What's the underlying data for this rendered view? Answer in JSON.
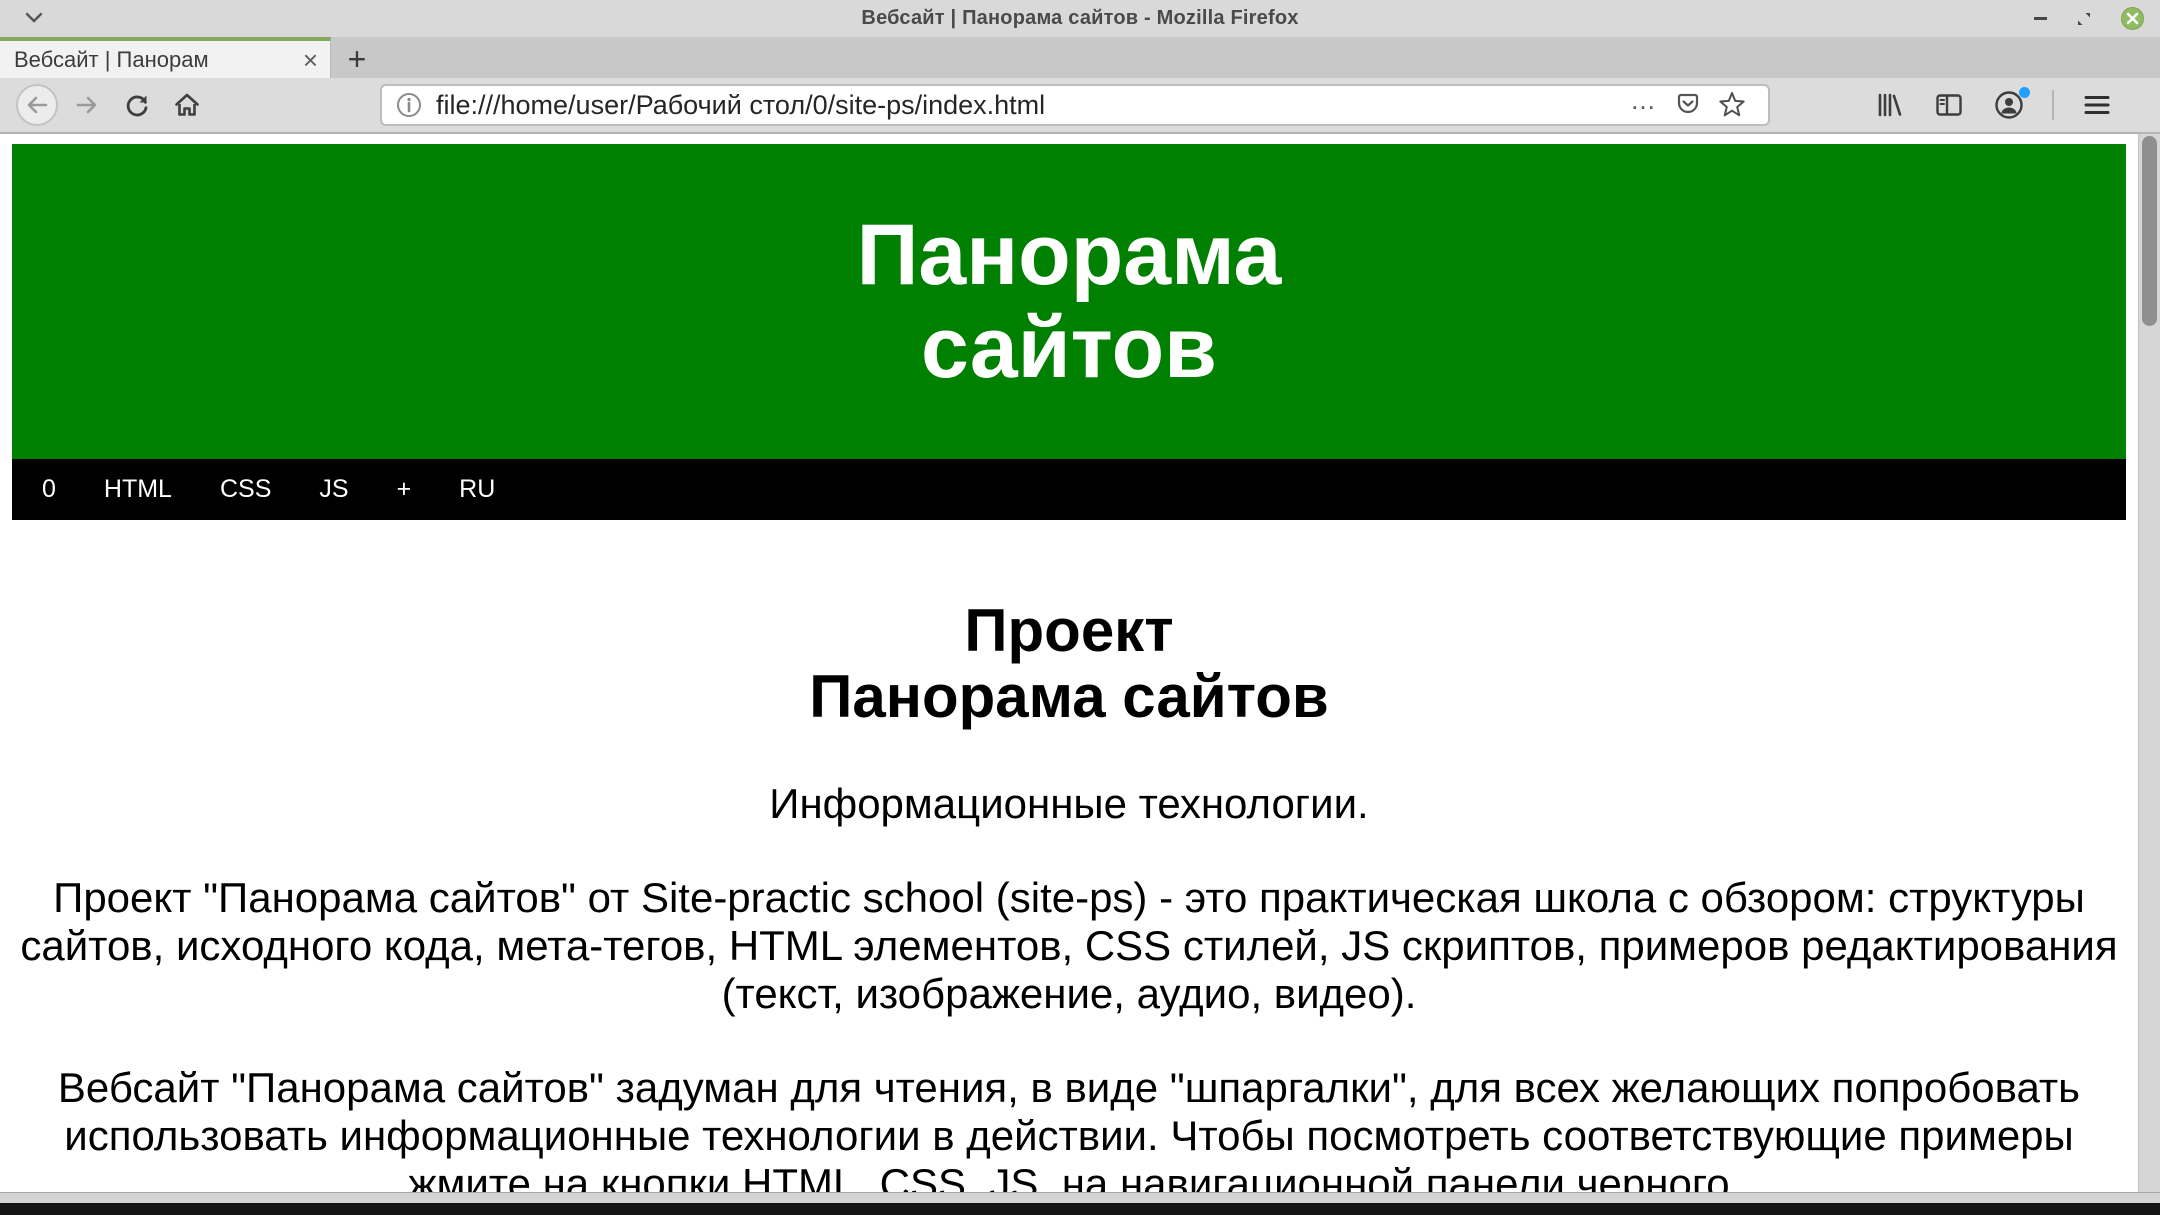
{
  "window": {
    "title": "Вебсайт | Панорама сайтов - Mozilla Firefox"
  },
  "tabbar": {
    "tab_title": "Вебсайт | Панорам",
    "tab_close": "×",
    "new_tab": "+"
  },
  "toolbar": {
    "url": "file:///home/user/Рабочий стол/0/site-ps/index.html",
    "page_actions": "…"
  },
  "page": {
    "hero_title_line1": "Панорама",
    "hero_title_line2": "сайтов",
    "nav_items": [
      "0",
      "HTML",
      "CSS",
      "JS",
      "+",
      "RU"
    ],
    "heading_line1": "Проект",
    "heading_line2": "Панорама сайтов",
    "subtitle": "Информационные технологии.",
    "paragraph1": "Проект \"Панорама сайтов\" от Site-practic school (site-ps) - это практическая школа с обзором: структуры сайтов, исходного кода, мета-тегов, HTML элементов, CSS стилей, JS скриптов, примеров редактирования (текст, изображение, аудио, видео).",
    "paragraph2": "Вебсайт \"Панорама сайтов\" задуман для чтения, в виде \"шпаргалки\", для всех желающих попробовать использовать информационные технологии в действии. Чтобы посмотреть соответствующие примеры жмите на кнопки HTML, CSS, JS, на навигационной панели черного"
  },
  "colors": {
    "hero_green": "#008000",
    "nav_black": "#000000",
    "tab_accent_green": "#84a85d",
    "close_button_green": "#8fbb63",
    "account_badge_blue": "#1f9fff"
  },
  "icons": [
    "chevron-down-icon",
    "minimize-icon",
    "restore-icon",
    "close-icon",
    "back-arrow-icon",
    "forward-arrow-icon",
    "reload-icon",
    "home-icon",
    "info-icon",
    "ellipsis-icon",
    "pocket-icon",
    "star-icon",
    "library-icon",
    "sidebar-icon",
    "account-icon",
    "menu-icon"
  ]
}
